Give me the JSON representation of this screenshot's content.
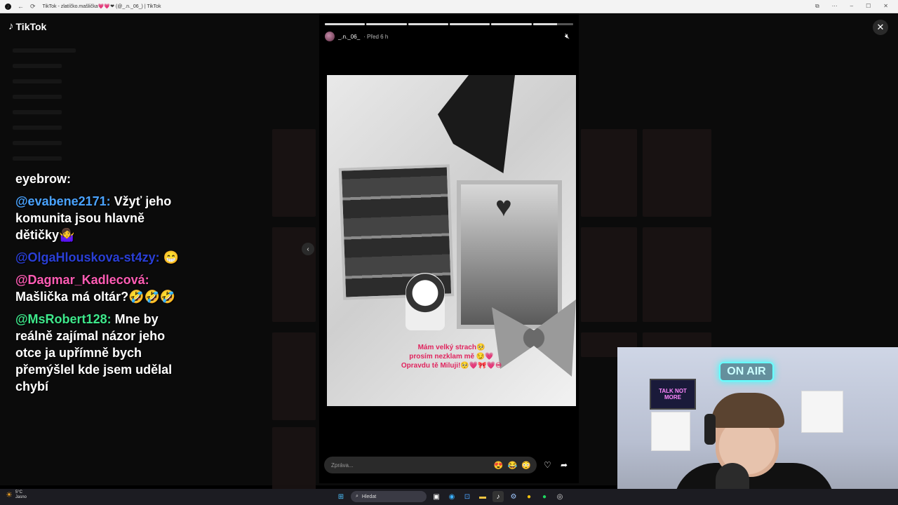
{
  "browser": {
    "tab_title": "TikTok - zlatíčko.mašlička💗💗❤ (@_.n._06_) | TikTok",
    "back_icon": "arrow-left-icon",
    "refresh_icon": "refresh-icon"
  },
  "app": {
    "name": "TikTok"
  },
  "chat": {
    "messages": [
      {
        "user": "",
        "text": "eyebrow:",
        "user_color": "#ffffff"
      },
      {
        "user": "@evabene2171",
        "text": "Vžyť jeho komunita jsou hlavně dětičky🤷‍♀️",
        "user_color": "#4aa3ff"
      },
      {
        "user": "@OlgaHlouskova-st4zy",
        "text": "😁",
        "user_color": "#2a3fd6"
      },
      {
        "user": "@Dagmar_Kadlecová",
        "text": "Mašlička má oltár?🤣🤣🤣",
        "user_color": "#ff5cb4"
      },
      {
        "user": "@MsRobert128",
        "text": "Mne by reálně zajímal názor jeho otce ja upřímně bych přemýšlel kde jsem udělal chybí",
        "user_color": "#3ee88b"
      }
    ]
  },
  "story": {
    "username": "_.n._06_",
    "time": "Před 6 h",
    "progress": [
      1,
      1,
      1,
      1,
      1,
      0.6
    ],
    "caption_lines": [
      "Mám velký strach🥺",
      "prosím nezklam mě 😏💗",
      "Opravdu tě Miluji!🥺💗🎀💗♾"
    ],
    "reply_placeholder": "Zpráva...",
    "quick_emojis": [
      "😍",
      "😂",
      "😳"
    ]
  },
  "webcam": {
    "neon_text": "ON AIR",
    "poster_text": "TALK NOT MORE"
  },
  "taskbar": {
    "temperature": "5°C",
    "weather": "Jasno",
    "search_label": "Hledat"
  }
}
